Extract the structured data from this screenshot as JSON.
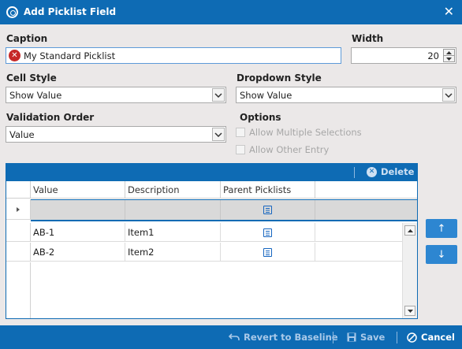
{
  "window": {
    "title": "Add Picklist Field",
    "app_icon": "picklist-icon",
    "close_glyph": "✕"
  },
  "caption": {
    "label": "Caption",
    "value": "My Standard Picklist",
    "error_icon": "error-icon"
  },
  "width": {
    "label": "Width",
    "value": "20"
  },
  "cell_style": {
    "label": "Cell Style",
    "value": "Show Value"
  },
  "dropdown_style": {
    "label": "Dropdown Style",
    "value": "Show Value"
  },
  "validation_order": {
    "label": "Validation Order",
    "value": "Value"
  },
  "options": {
    "label": "Options",
    "allow_multiple": "Allow Multiple Selections",
    "allow_other": "Allow Other Entry"
  },
  "grid": {
    "delete_label": "Delete",
    "columns": [
      "Value",
      "Description",
      "Parent Picklists"
    ],
    "rows": [
      {
        "value": "AB-1",
        "description": "Item1"
      },
      {
        "value": "AB-2",
        "description": "Item2"
      }
    ]
  },
  "move": {
    "up": "↑",
    "down": "↓"
  },
  "footer": {
    "revert": "Revert to Baseline",
    "save": "Save",
    "cancel": "Cancel"
  },
  "colors": {
    "accent": "#0e6bb4",
    "background": "#ebe8e8",
    "error": "#c62828",
    "move_button": "#2d86d1"
  }
}
